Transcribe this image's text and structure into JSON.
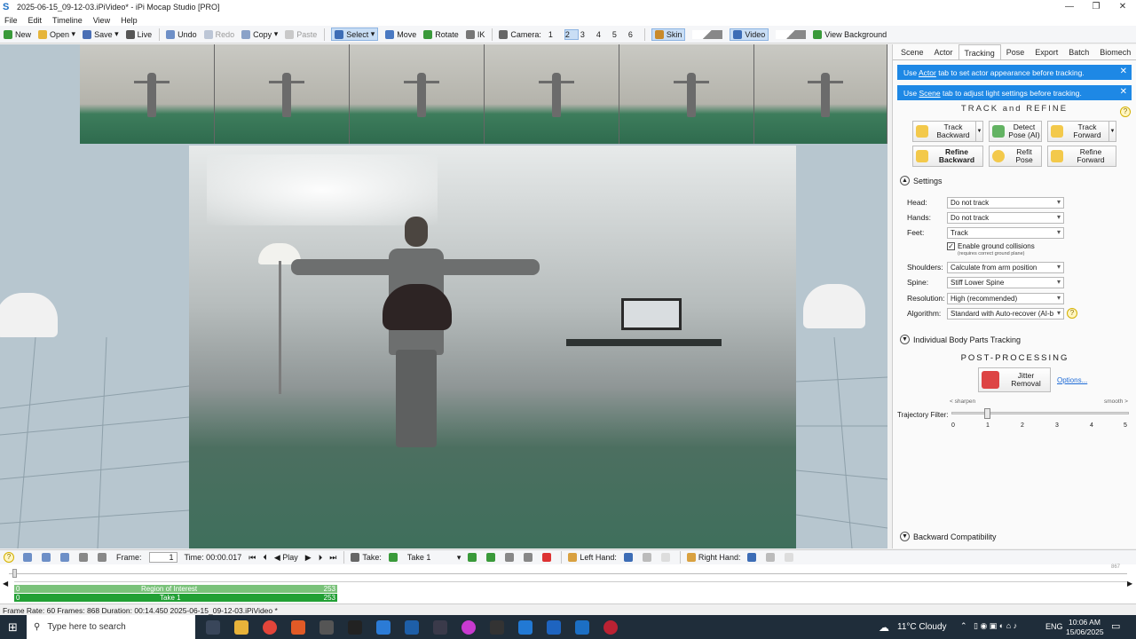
{
  "window": {
    "title": "2025-06-15_09-12-03.iPiVideo* - iPi Mocap Studio [PRO]",
    "controls": [
      "—",
      "❐",
      "✕"
    ]
  },
  "menu": [
    "File",
    "Edit",
    "Timeline",
    "View",
    "Help"
  ],
  "toolbar": {
    "new": "New",
    "open": "Open",
    "save": "Save",
    "live": "Live",
    "undo": "Undo",
    "redo": "Redo",
    "copy": "Copy",
    "paste": "Paste",
    "select": "Select",
    "move": "Move",
    "rotate": "Rotate",
    "ik": "IK",
    "camera_label": "Camera:",
    "cameras": [
      "1",
      "2",
      "3",
      "4",
      "5",
      "6"
    ],
    "active_camera": "2",
    "skin": "Skin",
    "video": "Video",
    "view_background": "View Background"
  },
  "right_panel": {
    "tabs": [
      "Scene",
      "Actor",
      "Tracking",
      "Pose",
      "Export",
      "Batch",
      "Biomech"
    ],
    "active_tab": "Tracking",
    "banner1": {
      "pre": "Use ",
      "link": "Actor",
      "post": " tab to set actor appearance before tracking."
    },
    "banner2": {
      "pre": "Use ",
      "link": "Scene",
      "post": " tab to adjust light settings before tracking."
    },
    "track_title": "TRACK and REFINE",
    "buttons": {
      "track_backward": "Track Backward",
      "detect_pose": "Detect Pose (AI)",
      "track_forward": "Track Forward",
      "refine_backward": "Refine Backward",
      "refit_pose": "Refit Pose",
      "refine_forward": "Refine Forward"
    },
    "settings_title": "Settings",
    "settings": {
      "head_label": "Head:",
      "head_value": "Do not track",
      "hands_label": "Hands:",
      "hands_value": "Do not track",
      "feet_label": "Feet:",
      "feet_value": "Track",
      "ground_label": "Enable ground collisions",
      "ground_note": "(requires correct ground plane)",
      "shoulders_label": "Shoulders:",
      "shoulders_value": "Calculate from arm position",
      "spine_label": "Spine:",
      "spine_value": "Stiff Lower Spine",
      "resolution_label": "Resolution:",
      "resolution_value": "High (recommended)",
      "algorithm_label": "Algorithm:",
      "algorithm_value": "Standard with Auto-recover (AI-b"
    },
    "individual_title": "Individual Body Parts Tracking",
    "post_title": "POST-PROCESSING",
    "jitter_label": "Jitter Removal",
    "options_link": "Options...",
    "sharpen": "< sharpen",
    "smooth": "smooth >",
    "traj_label": "Trajectory Filter:",
    "traj_ticks": [
      "0",
      "1",
      "2",
      "3",
      "4",
      "5"
    ],
    "traj_value": 1,
    "backward_title": "Backward Compatibility"
  },
  "bottom_toolbar": {
    "frame_label": "Frame:",
    "frame_value": "1",
    "time_label": "Time: 00:00.017",
    "play": "Play",
    "take_label": "Take:",
    "take_value": "Take 1",
    "left_hand": "Left Hand:",
    "right_hand": "Right Hand:"
  },
  "timeline": {
    "end_frame": "867",
    "roi_label": "Region of Interest",
    "roi_start": "0",
    "roi_end": "253",
    "take_label": "Take 1",
    "take_start": "0",
    "take_end": "253"
  },
  "status": "Frame Rate: 60  Frames: 868  Duration: 00:14.450  2025-06-15_09-12-03.iPiVideo *",
  "taskbar": {
    "search_placeholder": "Type here to search",
    "weather": "11°C  Cloudy",
    "lang": "ENG",
    "time": "10:06 AM",
    "date": "15/06/2025"
  },
  "colors": {
    "accent": "#1e88e5",
    "roi_bar": "#7ac27a",
    "take_bar": "#22a035",
    "taskbar": "#1f2d3a"
  }
}
